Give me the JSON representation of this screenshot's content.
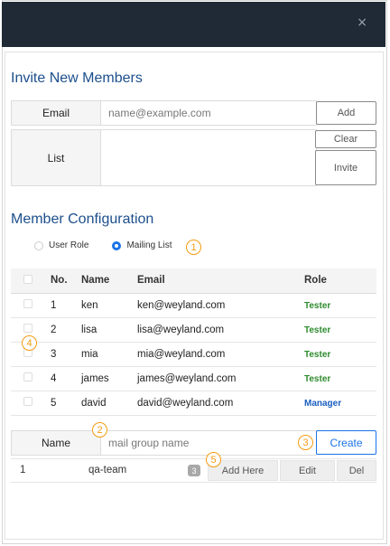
{
  "dialog": {
    "close_glyph": "×"
  },
  "invite": {
    "title": "Invite New Members",
    "email_label": "Email",
    "email_placeholder": "name@example.com",
    "add_button": "Add",
    "list_label": "List",
    "clear_button": "Clear",
    "invite_button": "Invite"
  },
  "config": {
    "title": "Member Configuration",
    "radio_user_role": "User Role",
    "radio_mailing_list": "Mailing List",
    "selected": "Mailing List"
  },
  "markers": {
    "m1": "1",
    "m2": "2",
    "m3": "3",
    "m4": "4",
    "m5": "5"
  },
  "table": {
    "headers": {
      "no": "No.",
      "name": "Name",
      "email": "Email",
      "role": "Role"
    },
    "rows": [
      {
        "no": "1",
        "name": "ken",
        "email": "ken@weyland.com",
        "role": "Tester"
      },
      {
        "no": "2",
        "name": "lisa",
        "email": "lisa@weyland.com",
        "role": "Tester"
      },
      {
        "no": "3",
        "name": "mia",
        "email": "mia@weyland.com",
        "role": "Tester"
      },
      {
        "no": "4",
        "name": "james",
        "email": "james@weyland.com",
        "role": "Tester"
      },
      {
        "no": "5",
        "name": "david",
        "email": "david@weyland.com",
        "role": "Manager"
      }
    ]
  },
  "group": {
    "name_label": "Name",
    "name_placeholder": "mail group name",
    "create_button": "Create",
    "rows": [
      {
        "index": "1",
        "name": "qa-team",
        "count": "3",
        "add_here": "Add Here",
        "edit": "Edit",
        "del": "Del"
      }
    ]
  },
  "colors": {
    "header_bg": "#1f2a36",
    "title": "#1d4f8c",
    "accent": "#1a73e8",
    "tester": "#2e8b2e",
    "manager": "#1a5fbf",
    "marker": "#f39c12"
  }
}
